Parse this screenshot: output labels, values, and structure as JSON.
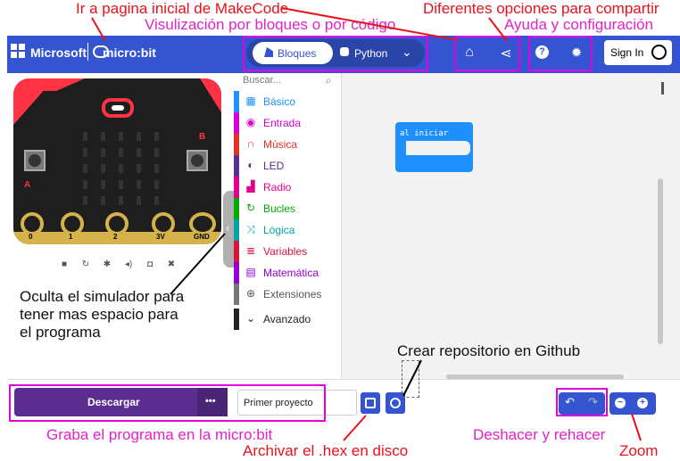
{
  "annotations": {
    "home": "Ir a pagina inicial de MakeCode",
    "share": "Diferentes opciones para compartir",
    "editor_mode": "Visulización por bloques o por código",
    "help": "Ayuda y configuración",
    "simulator_line1": "Oculta el simulador para",
    "simulator_line2": "tener mas espacio para",
    "simulator_line3": "el programa",
    "github": "Crear repositorio en Github",
    "download": "Graba el programa en la micro:bit",
    "save": "Archivar el .hex en disco",
    "undo": "Deshacer y rehacer",
    "zoom": "Zoom"
  },
  "header": {
    "brand": "Microsoft",
    "product": "micro:bit",
    "tab_blocks": "Bloques",
    "tab_python": "Python",
    "sign_in": "Sign In"
  },
  "toolbox": {
    "search_placeholder": "Buscar...",
    "items": [
      {
        "label": "Básico",
        "color": "#1e90ff"
      },
      {
        "label": "Entrada",
        "color": "#d400d4"
      },
      {
        "label": "Música",
        "color": "#e63022"
      },
      {
        "label": "LED",
        "color": "#5c2d91"
      },
      {
        "label": "Radio",
        "color": "#e3008c"
      },
      {
        "label": "Bucles",
        "color": "#00aa00"
      },
      {
        "label": "Lógica",
        "color": "#00a4a6"
      },
      {
        "label": "Variables",
        "color": "#dc143c"
      },
      {
        "label": "Matemática",
        "color": "#9400d3"
      },
      {
        "label": "Extensiones",
        "color": "#777777"
      },
      {
        "label": "Avanzado",
        "color": "#222222"
      }
    ]
  },
  "workspace": {
    "block_label": "al iniciar",
    "block_color": "#1e90ff"
  },
  "simulator": {
    "pins": [
      "0",
      "1",
      "2",
      "3V",
      "GND"
    ],
    "button_a": "A",
    "button_b": "B"
  },
  "footer": {
    "download": "Descargar",
    "more": "•••",
    "project_name": "Primer proyecto"
  },
  "colors": {
    "header": "#3454d1",
    "download": "#5c2d91",
    "accent": "#3454d1"
  }
}
